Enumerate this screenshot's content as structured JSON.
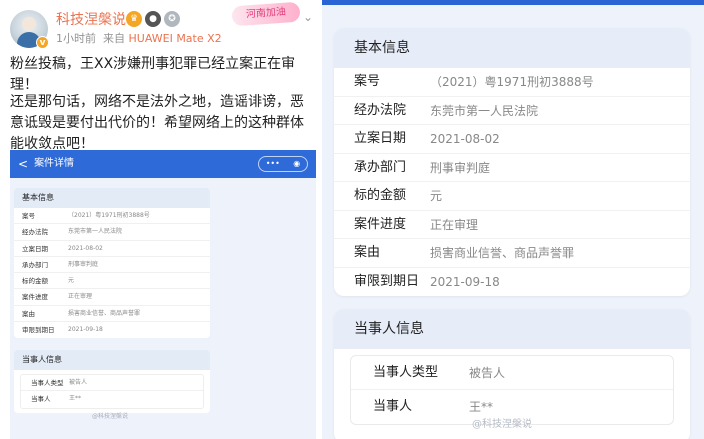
{
  "post": {
    "username": "科技涅槃说",
    "time": "1小时前",
    "source_prefix": "来自",
    "device": "HUAWEI Mate X2",
    "promo_tag": "河南加油",
    "badge_v": "v",
    "para1": "粉丝投稿，王XX涉嫌刑事犯罪已经立案正在审理！",
    "para2": "还是那句话，网络不是法外之地，造谣诽谤，恶意诋毁是要付出代价的！希望网络上的这种群体能收敛点吧！",
    "icons": [
      "avatar",
      "verified-badge",
      "crown-badge",
      "panda-badge",
      "medal-badge",
      "chevron-down-icon"
    ]
  },
  "embedded": {
    "back_label": "<",
    "title": "案件详情",
    "capsule_more": "•••",
    "capsule_close": "◉",
    "watermark": "@科技涅槃说"
  },
  "case": {
    "basic_title": "基本信息",
    "fields": [
      {
        "label": "案号",
        "value": "（2021）粤1971刑初3888号"
      },
      {
        "label": "经办法院",
        "value": "东莞市第一人民法院"
      },
      {
        "label": "立案日期",
        "value": "2021-08-02"
      },
      {
        "label": "承办部门",
        "value": "刑事审判庭"
      },
      {
        "label": "标的金额",
        "value": "元"
      },
      {
        "label": "案件进度",
        "value": "正在审理"
      },
      {
        "label": "案由",
        "value": "损害商业信誉、商品声誉罪"
      },
      {
        "label": "审限到期日",
        "value": "2021-09-18"
      }
    ],
    "party_title": "当事人信息",
    "parties": [
      {
        "label": "当事人类型",
        "value": "被告人"
      },
      {
        "label": "当事人",
        "value": "王**"
      }
    ]
  },
  "zoom_watermark": "@科技涅槃说"
}
